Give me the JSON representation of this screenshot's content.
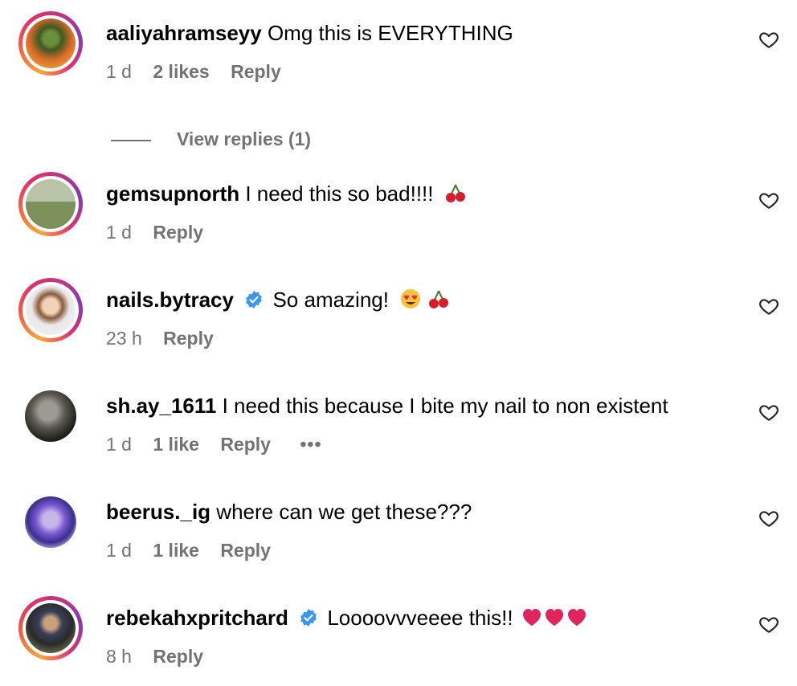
{
  "comments": [
    {
      "username": "aaliyahramseyy",
      "text": "Omg this is EVERYTHING",
      "time": "1 d",
      "likes": "2 likes",
      "reply": "Reply",
      "verified": false
    },
    {
      "username": "gemsupnorth",
      "text": "I need this so bad!!!!",
      "time": "1 d",
      "reply": "Reply",
      "verified": false
    },
    {
      "username": "nails.bytracy",
      "text": "So amazing!",
      "time": "23 h",
      "reply": "Reply",
      "verified": true
    },
    {
      "username": "sh.ay_1611",
      "text": "I need this because I bite my nail to non existent",
      "time": "1 d",
      "likes": "1 like",
      "reply": "Reply",
      "more": "•••",
      "verified": false
    },
    {
      "username": "beerus._ig",
      "text": "where can we get these???",
      "time": "1 d",
      "likes": "1 like",
      "reply": "Reply",
      "verified": false
    },
    {
      "username": "rebekahxpritchard",
      "text": "Loooovvveeee this!!",
      "time": "8 h",
      "reply": "Reply",
      "verified": true
    }
  ],
  "view_replies": "View replies (1)",
  "colors": {
    "meta": "#737373",
    "verified": "#3897f0",
    "heart_emoji": "#e0245e"
  }
}
